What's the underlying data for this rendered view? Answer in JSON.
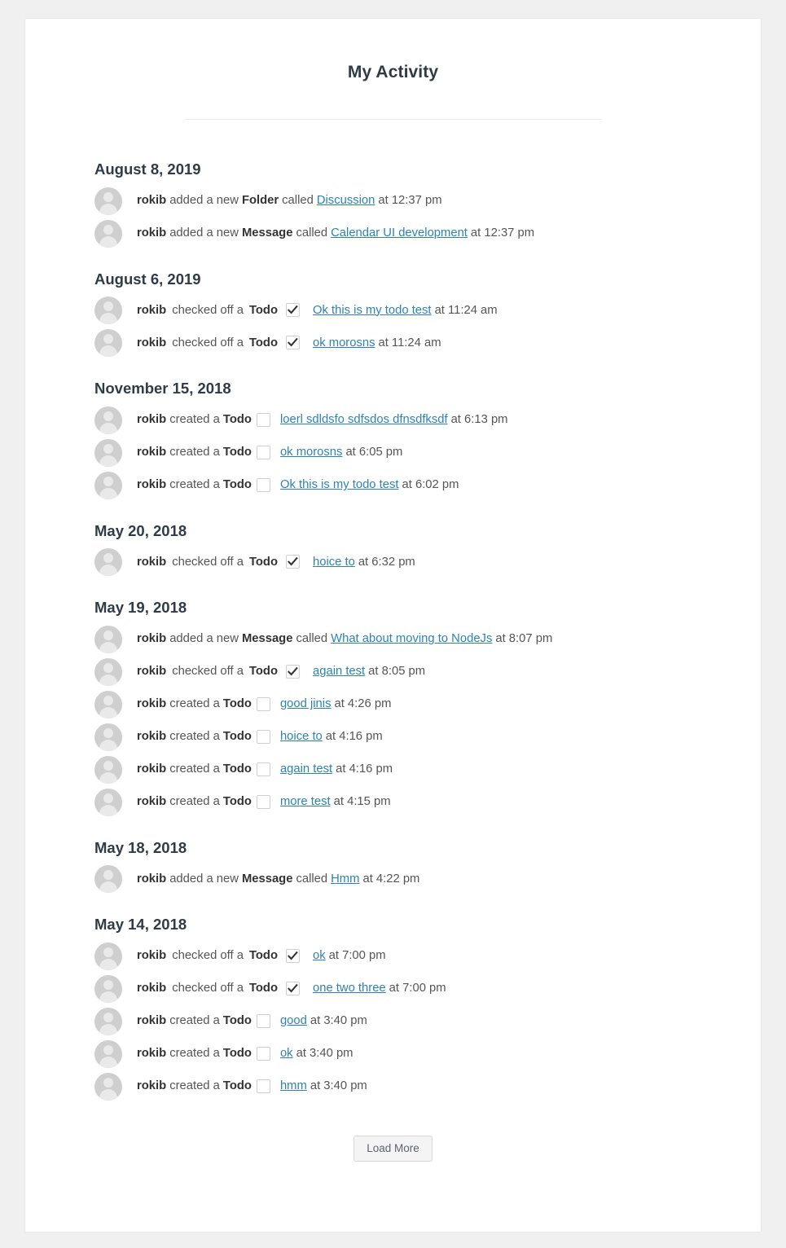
{
  "page": {
    "title": "My Activity",
    "background_color": "#f0f0f0",
    "card_color": "#ffffff",
    "link_color": "#2d82b5",
    "heading_color": "#2f3b46"
  },
  "groups": [
    {
      "date": "August 8, 2019",
      "items": [
        {
          "user": "rokib",
          "verb": "added a new",
          "type": "Folder",
          "connector": "called",
          "checkbox": "none",
          "target": "Discussion",
          "time": "at 12:37 pm"
        },
        {
          "user": "rokib",
          "verb": "added a new",
          "type": "Message",
          "connector": "called",
          "checkbox": "none",
          "target": "Calendar UI development",
          "time": "at 12:37 pm"
        }
      ]
    },
    {
      "date": "August 6, 2019",
      "items": [
        {
          "user": "rokib",
          "verb": "checked off a",
          "type": "Todo",
          "connector": "",
          "checkbox": "checked",
          "target": "Ok this is my todo test",
          "time": "at 11:24 am"
        },
        {
          "user": "rokib",
          "verb": "checked off a",
          "type": "Todo",
          "connector": "",
          "checkbox": "checked",
          "target": "ok morosns",
          "time": "at 11:24 am"
        }
      ]
    },
    {
      "date": "November 15, 2018",
      "items": [
        {
          "user": "rokib",
          "verb": "created a",
          "type": "Todo",
          "connector": "",
          "checkbox": "unchecked",
          "target": "loerl sdldsfo sdfsdos dfnsdfksdf",
          "time": "at 6:13 pm"
        },
        {
          "user": "rokib",
          "verb": "created a",
          "type": "Todo",
          "connector": "",
          "checkbox": "unchecked",
          "target": "ok morosns",
          "time": "at 6:05 pm"
        },
        {
          "user": "rokib",
          "verb": "created a",
          "type": "Todo",
          "connector": "",
          "checkbox": "unchecked",
          "target": "Ok this is my todo test",
          "time": "at 6:02 pm"
        }
      ]
    },
    {
      "date": "May 20, 2018",
      "items": [
        {
          "user": "rokib",
          "verb": "checked off a",
          "type": "Todo",
          "connector": "",
          "checkbox": "checked",
          "target": "hoice to",
          "time": "at 6:32 pm"
        }
      ]
    },
    {
      "date": "May 19, 2018",
      "items": [
        {
          "user": "rokib",
          "verb": "added a new",
          "type": "Message",
          "connector": "called",
          "checkbox": "none",
          "target": "What about moving to NodeJs",
          "time": "at 8:07 pm"
        },
        {
          "user": "rokib",
          "verb": "checked off a",
          "type": "Todo",
          "connector": "",
          "checkbox": "checked",
          "target": "again test",
          "time": "at 8:05 pm"
        },
        {
          "user": "rokib",
          "verb": "created a",
          "type": "Todo",
          "connector": "",
          "checkbox": "unchecked",
          "target": "good jinis",
          "time": "at 4:26 pm"
        },
        {
          "user": "rokib",
          "verb": "created a",
          "type": "Todo",
          "connector": "",
          "checkbox": "unchecked",
          "target": "hoice to",
          "time": "at 4:16 pm"
        },
        {
          "user": "rokib",
          "verb": "created a",
          "type": "Todo",
          "connector": "",
          "checkbox": "unchecked",
          "target": "again test",
          "time": "at 4:16 pm"
        },
        {
          "user": "rokib",
          "verb": "created a",
          "type": "Todo",
          "connector": "",
          "checkbox": "unchecked",
          "target": "more test",
          "time": "at 4:15 pm"
        }
      ]
    },
    {
      "date": "May 18, 2018",
      "items": [
        {
          "user": "rokib",
          "verb": "added a new",
          "type": "Message",
          "connector": "called",
          "checkbox": "none",
          "target": "Hmm",
          "time": "at 4:22 pm"
        }
      ]
    },
    {
      "date": "May 14, 2018",
      "items": [
        {
          "user": "rokib",
          "verb": "checked off a",
          "type": "Todo",
          "connector": "",
          "checkbox": "checked",
          "target": "ok",
          "time": "at 7:00 pm"
        },
        {
          "user": "rokib",
          "verb": "checked off a",
          "type": "Todo",
          "connector": "",
          "checkbox": "checked",
          "target": "one two three",
          "time": "at 7:00 pm"
        },
        {
          "user": "rokib",
          "verb": "created a",
          "type": "Todo",
          "connector": "",
          "checkbox": "unchecked",
          "target": "good",
          "time": "at 3:40 pm"
        },
        {
          "user": "rokib",
          "verb": "created a",
          "type": "Todo",
          "connector": "",
          "checkbox": "unchecked",
          "target": "ok",
          "time": "at 3:40 pm"
        },
        {
          "user": "rokib",
          "verb": "created a",
          "type": "Todo",
          "connector": "",
          "checkbox": "unchecked",
          "target": "hmm",
          "time": "at 3:40 pm"
        }
      ]
    }
  ],
  "footer": {
    "load_more_label": "Load More"
  },
  "icons": {
    "avatar": "user-avatar-icon",
    "checked": "checkbox-checked-icon",
    "unchecked": "checkbox-unchecked-icon"
  }
}
